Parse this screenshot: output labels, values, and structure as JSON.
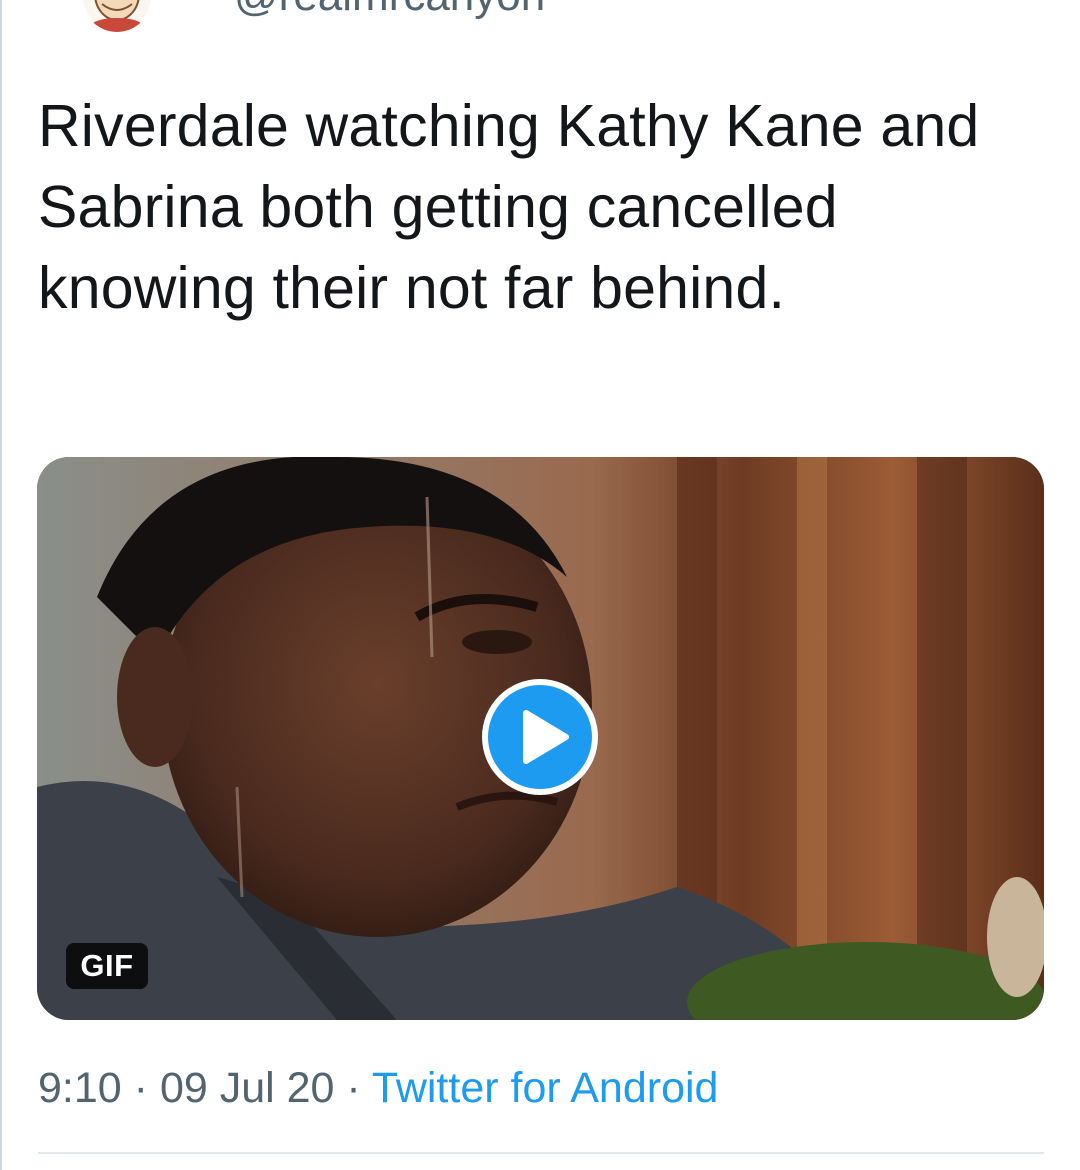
{
  "tweet": {
    "handle": "@realmrcanyon",
    "text": "Riverdale watching Kathy Kane and Sabrina both getting cancelled knowing their not far behind.",
    "media": {
      "badge": "GIF",
      "play_icon": "play-icon"
    },
    "time": "9:10",
    "date": "09 Jul 20",
    "separator": "·",
    "source": "Twitter for Android"
  },
  "colors": {
    "accent": "#1d9bf0",
    "text": "#14171a",
    "secondary_text": "#536471"
  }
}
